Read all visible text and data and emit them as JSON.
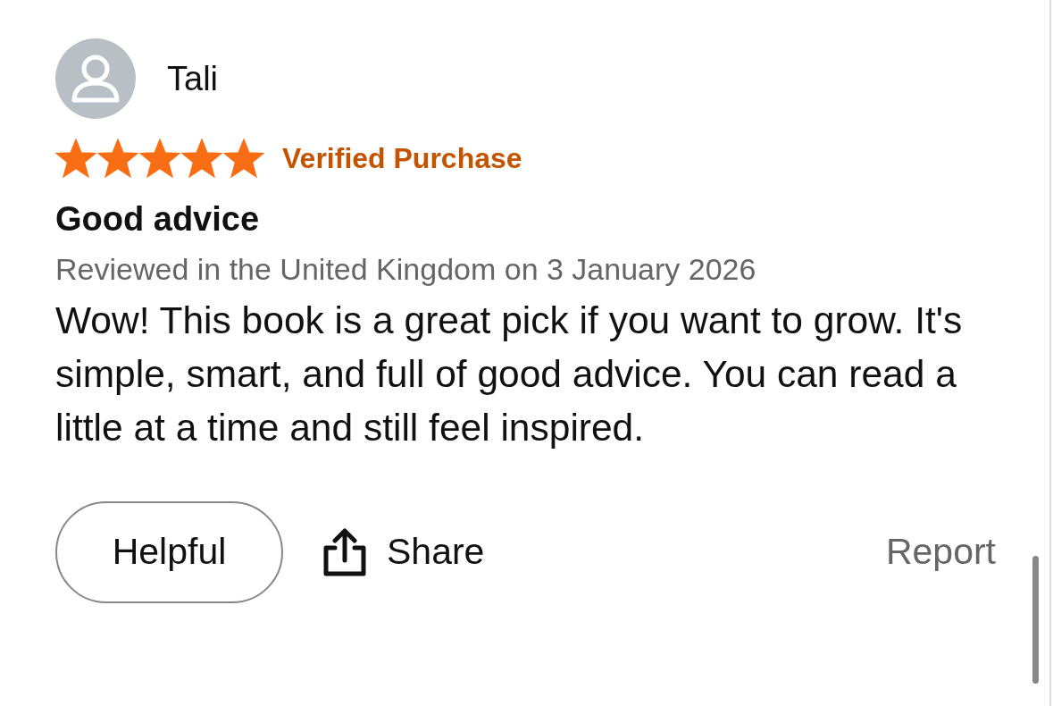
{
  "reviewer": {
    "name": "Tali"
  },
  "rating": {
    "stars": 5,
    "badge": "Verified Purchase"
  },
  "title": "Good advice",
  "meta": "Reviewed in the United Kingdom on 3 January 2026",
  "body": "Wow! This book is a great pick if you want to grow. It's simple, smart, and full of good advice. You can read a little at a time and still feel inspired.",
  "actions": {
    "helpful": "Helpful",
    "share": "Share",
    "report": "Report"
  }
}
